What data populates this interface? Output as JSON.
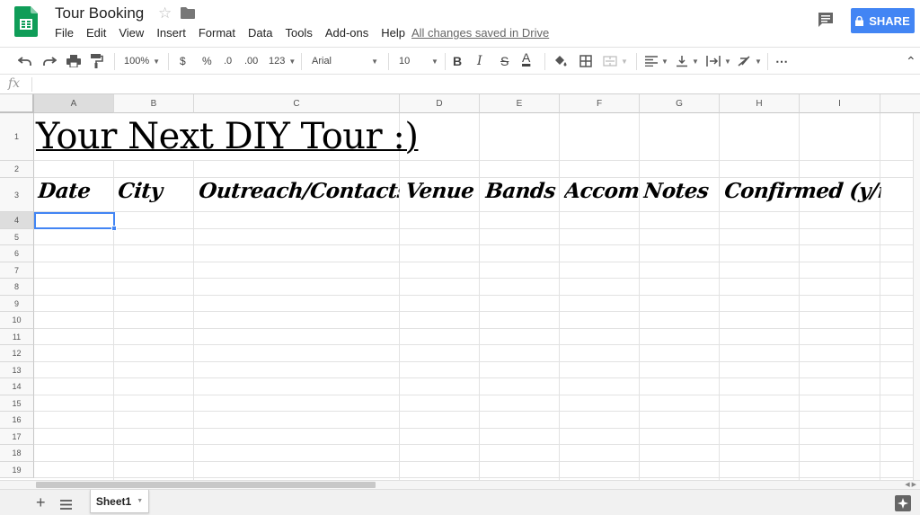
{
  "app": {
    "title": "Tour Booking",
    "menu": [
      "File",
      "Edit",
      "View",
      "Insert",
      "Format",
      "Data",
      "Tools",
      "Add-ons",
      "Help"
    ],
    "save_status": "All changes saved in Drive",
    "share_label": "SHARE",
    "accent_color": "#4285f4",
    "logo_color": "#0f9d58"
  },
  "toolbar": {
    "zoom": "100%",
    "currency": "$",
    "percent": "%",
    "decrease_decimals": ".0",
    "increase_decimals": ".00",
    "more_formats": "123",
    "font": "Arial",
    "font_size": "10",
    "bold": "B",
    "italic": "I",
    "strikethrough": "S",
    "text_color": "A",
    "more": "⋯",
    "collapse": "⌃"
  },
  "formula_bar": {
    "fx_label": "fx",
    "value": ""
  },
  "grid": {
    "columns": [
      "A",
      "B",
      "C",
      "D",
      "E",
      "F",
      "G",
      "H",
      "I"
    ],
    "rows": [
      "1",
      "2",
      "3",
      "4",
      "5",
      "6",
      "7",
      "8",
      "9",
      "10",
      "11",
      "12",
      "13",
      "14",
      "15",
      "16",
      "17",
      "18",
      "19"
    ],
    "selected_cell": "A4",
    "title_cell": "Your Next DIY Tour :)",
    "header_cells": [
      "Date",
      "City",
      "Outreach/Contacts",
      "Venue",
      "Bands",
      "Accomodations",
      "Notes",
      "Confirmed (y/n)"
    ]
  },
  "sheets": {
    "add_label": "+",
    "tabs": [
      {
        "label": "Sheet1",
        "active": true
      }
    ]
  }
}
